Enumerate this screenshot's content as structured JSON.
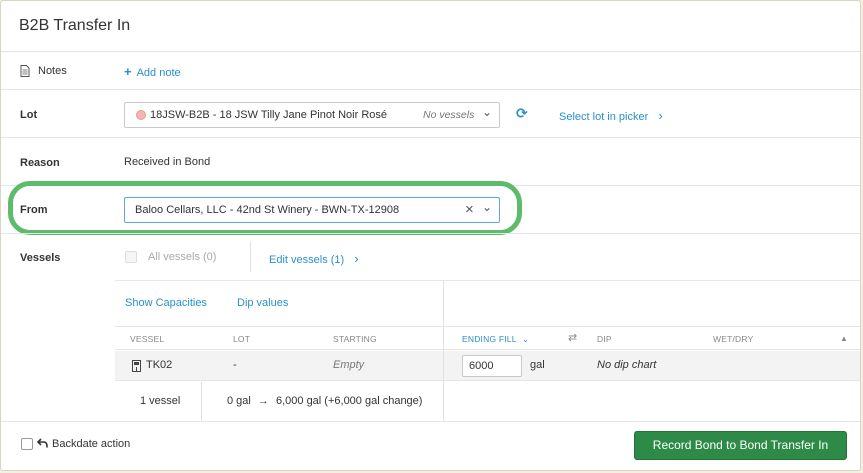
{
  "header": {
    "title": "B2B Transfer In"
  },
  "notes": {
    "label": "Notes",
    "add_note": "Add note",
    "plus": "+"
  },
  "lot": {
    "label": "Lot",
    "value": "18JSW-B2B - 18 JSW Tilly Jane Pinot Noir Rosé",
    "vessels_hint": "No vessels",
    "picker_link": "Select lot in picker",
    "chevron": "›",
    "caret": "⌄",
    "refresh": "⟳"
  },
  "reason": {
    "label": "Reason",
    "value": "Received in Bond"
  },
  "from": {
    "label": "From",
    "value": "Baloo Cellars, LLC - 42nd St Winery - BWN-TX-12908",
    "clear": "×",
    "caret": "⌄"
  },
  "vessels": {
    "label": "Vessels",
    "all_vessels": "All vessels (0)",
    "edit_vessels": "Edit vessels (1)",
    "chevron": "›",
    "show_capacities": "Show Capacities",
    "dip_values": "Dip values"
  },
  "table": {
    "headers": {
      "vessel": "VESSEL",
      "lot": "LOT",
      "starting": "STARTING",
      "ending_fill": "ENDING FILL",
      "ending_caret": "⌄",
      "swap": "⇄",
      "dip": "DIP",
      "wet_dry": "WET/DRY",
      "sort": "▲"
    },
    "row": {
      "vessel": "TK02",
      "lot": "-",
      "starting": "Empty",
      "ending_value": "6000",
      "unit": "gal",
      "dip": "No dip chart"
    },
    "summary": {
      "count": "1 vessel",
      "from": "0 gal",
      "arrow": "→",
      "to": "6,000 gal (+6,000 gal change)"
    }
  },
  "footer": {
    "backdate_label": "Backdate action",
    "submit_button": "Record Bond to Bond Transfer In"
  },
  "colors": {
    "accent_link": "#2a90c9",
    "primary_button": "#2e8b47",
    "highlight_ring": "#5dbb6c",
    "background": "#f4efe0"
  }
}
